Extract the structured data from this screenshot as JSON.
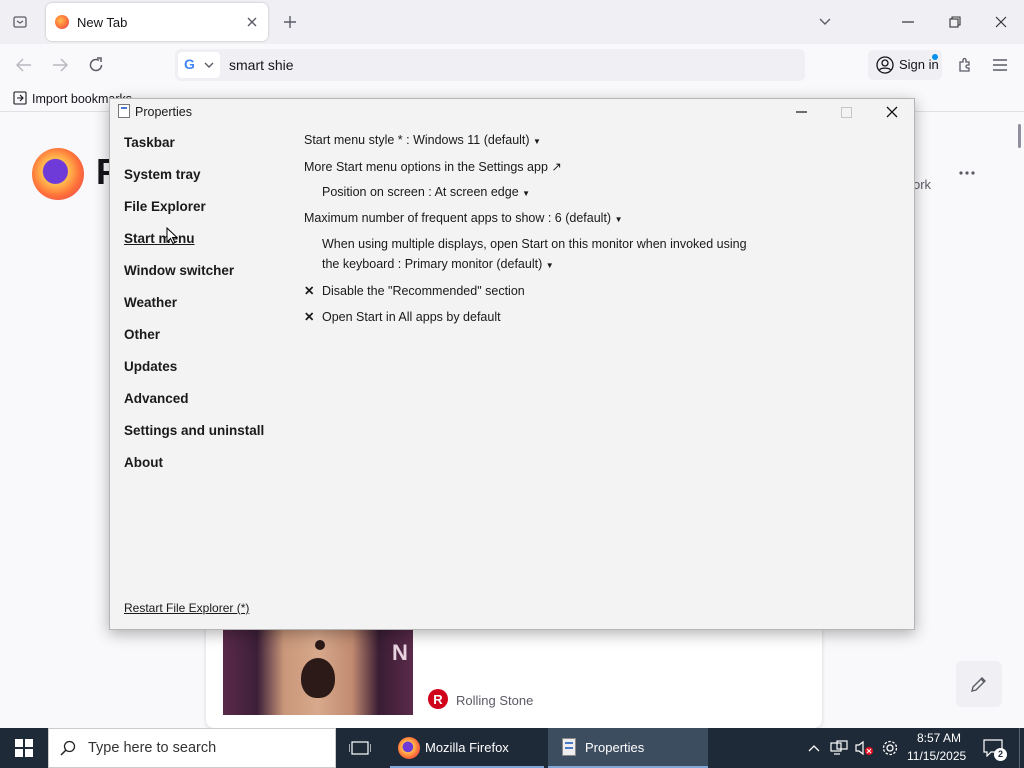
{
  "browser": {
    "tab_title": "New Tab",
    "url_text": "smart shie",
    "sign_in": "Sign in",
    "bookmark_import": "Import bookmarks..."
  },
  "background_page": {
    "logo_letter": "F",
    "partial_text": "ork",
    "card_source": "Rolling Stone",
    "portrait_letter": "N"
  },
  "dialog": {
    "title": "Properties",
    "nav": [
      "Taskbar",
      "System tray",
      "File Explorer",
      "Start menu",
      "Window switcher",
      "Weather",
      "Other",
      "Updates",
      "Advanced",
      "Settings and uninstall",
      "About"
    ],
    "selected_nav": "Start menu",
    "options": {
      "menu_style": "Start menu style * : Windows 11 (default)",
      "more_options": "More Start menu options in the Settings app",
      "position": "Position on screen : At screen edge",
      "max_apps": "Maximum number of frequent apps to show : 6 (default)",
      "multi_display_1": "When using multiple displays, open Start on this monitor when invoked using",
      "multi_display_2": "the keyboard : Primary monitor (default)",
      "disable_recommended": "Disable the \"Recommended\" section",
      "open_all_apps": "Open Start in All apps by default"
    },
    "restart_link": "Restart File Explorer (*)"
  },
  "taskbar": {
    "search_placeholder": "Type here to search",
    "apps": [
      "Mozilla Firefox",
      "Properties"
    ],
    "time": "8:57 AM",
    "date": "11/15/2025",
    "notification_count": "2"
  },
  "colors": {
    "taskbar": "#1f2a38",
    "accent": "#0060df",
    "firefox_orange": "#ff7139"
  }
}
